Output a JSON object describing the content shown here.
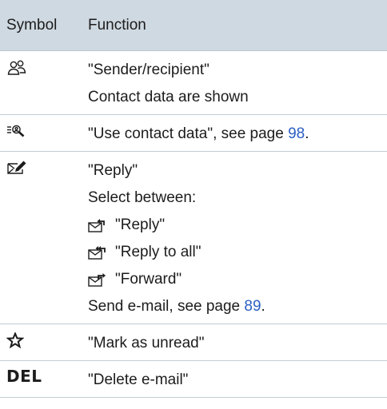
{
  "header": {
    "symbol": "Symbol",
    "function": "Function"
  },
  "rows": {
    "sender": {
      "icon": "people-icon",
      "title": "\"Sender/recipient\"",
      "desc": "Contact data are shown"
    },
    "contact": {
      "icon": "magnifier-icon",
      "text": "\"Use contact data\", see page ",
      "page": "98",
      "end": "."
    },
    "reply": {
      "icon": "envelope-pencil-icon",
      "title": "\"Reply\"",
      "select": "Select between:",
      "opt1": "\"Reply\"",
      "opt2": "\"Reply to all\"",
      "opt3": "\"Forward\"",
      "send": "Send e-mail, see page ",
      "page": "89",
      "end": "."
    },
    "unread": {
      "icon": "star-icon",
      "text": "\"Mark as unread\""
    },
    "delete": {
      "icon": "del-label",
      "label": "DEL",
      "text": "\"Delete e-mail\""
    }
  },
  "colors": {
    "header_bg": "#cfd9e1",
    "link": "#2b5fc4",
    "divider": "#c4ccd3"
  }
}
